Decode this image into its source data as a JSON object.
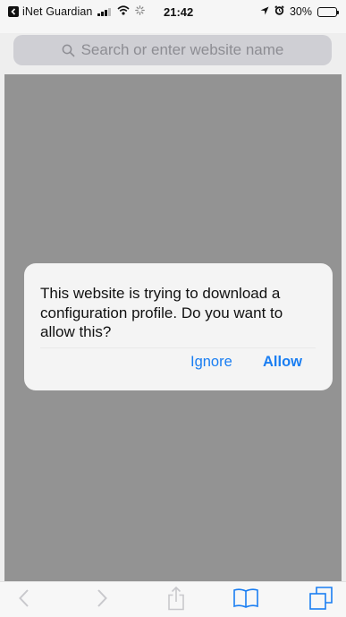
{
  "status_bar": {
    "carrier": "iNet Guardian",
    "time": "21:42",
    "battery_percent": "30%",
    "battery_level": 0.3,
    "icons": [
      "back-to-app-icon",
      "signal-icon",
      "wifi-icon",
      "activity-icon",
      "location-icon",
      "alarm-icon",
      "battery-icon"
    ]
  },
  "address_bar": {
    "placeholder": "Search or enter website name",
    "icon": "search-icon"
  },
  "alert": {
    "message": "This website is trying to download a configuration profile. Do you want to allow this?",
    "ignore_label": "Ignore",
    "allow_label": "Allow"
  },
  "toolbar": {
    "items": [
      "back-icon",
      "forward-icon",
      "share-icon",
      "bookmarks-icon",
      "tabs-icon"
    ]
  },
  "colors": {
    "accent": "#1a7ef2",
    "dimmed_content": "#939393",
    "alert_background": "#f4f4f4",
    "toolbar_background": "#f7f7f7"
  }
}
